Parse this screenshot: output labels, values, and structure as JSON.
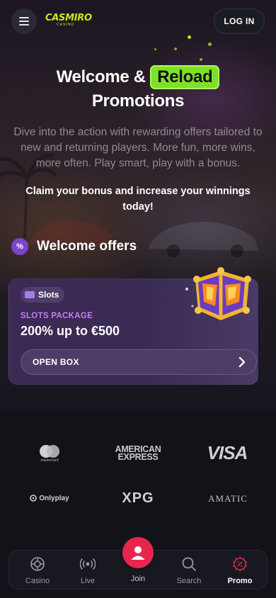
{
  "header": {
    "logo_text": "CASMIRO",
    "logo_sub": "CASINO",
    "login_label": "LOG IN"
  },
  "hero": {
    "title_part1": "Welcome &",
    "title_highlight": "Reload",
    "title_part2": "Promotions",
    "subtitle": "Dive into the action with rewarding offers tailored to new and returning players. More fun, more wins, more often. Play smart, play with a bonus.",
    "claim": "Claim your bonus and increase your winnings today!"
  },
  "section": {
    "icon_glyph": "%",
    "title": "Welcome offers"
  },
  "offer_card": {
    "tag_label": "Slots",
    "package_label": "SLOTS PACKAGE",
    "amount": "200% up to €500",
    "button_label": "OPEN BOX"
  },
  "partners": {
    "mastercard": "mastercard",
    "amex_line1": "AMERICAN",
    "amex_line2": "EXPRESS",
    "visa": "VISA",
    "onlyplay": "Onlyplay",
    "xpg": "XPG",
    "amatic": "AMATIC"
  },
  "bottom_nav": {
    "items": [
      {
        "label": "Casino",
        "icon": "roulette-icon"
      },
      {
        "label": "Live",
        "icon": "live-broadcast-icon"
      },
      {
        "label": "Join",
        "icon": "user-icon"
      },
      {
        "label": "Search",
        "icon": "search-icon"
      },
      {
        "label": "Promo",
        "icon": "promo-badge-icon"
      }
    ]
  },
  "colors": {
    "accent_green": "#7fe02c",
    "accent_purple": "#7a46c8",
    "join_red": "#e8264d",
    "promo_pink": "#e8264d"
  }
}
